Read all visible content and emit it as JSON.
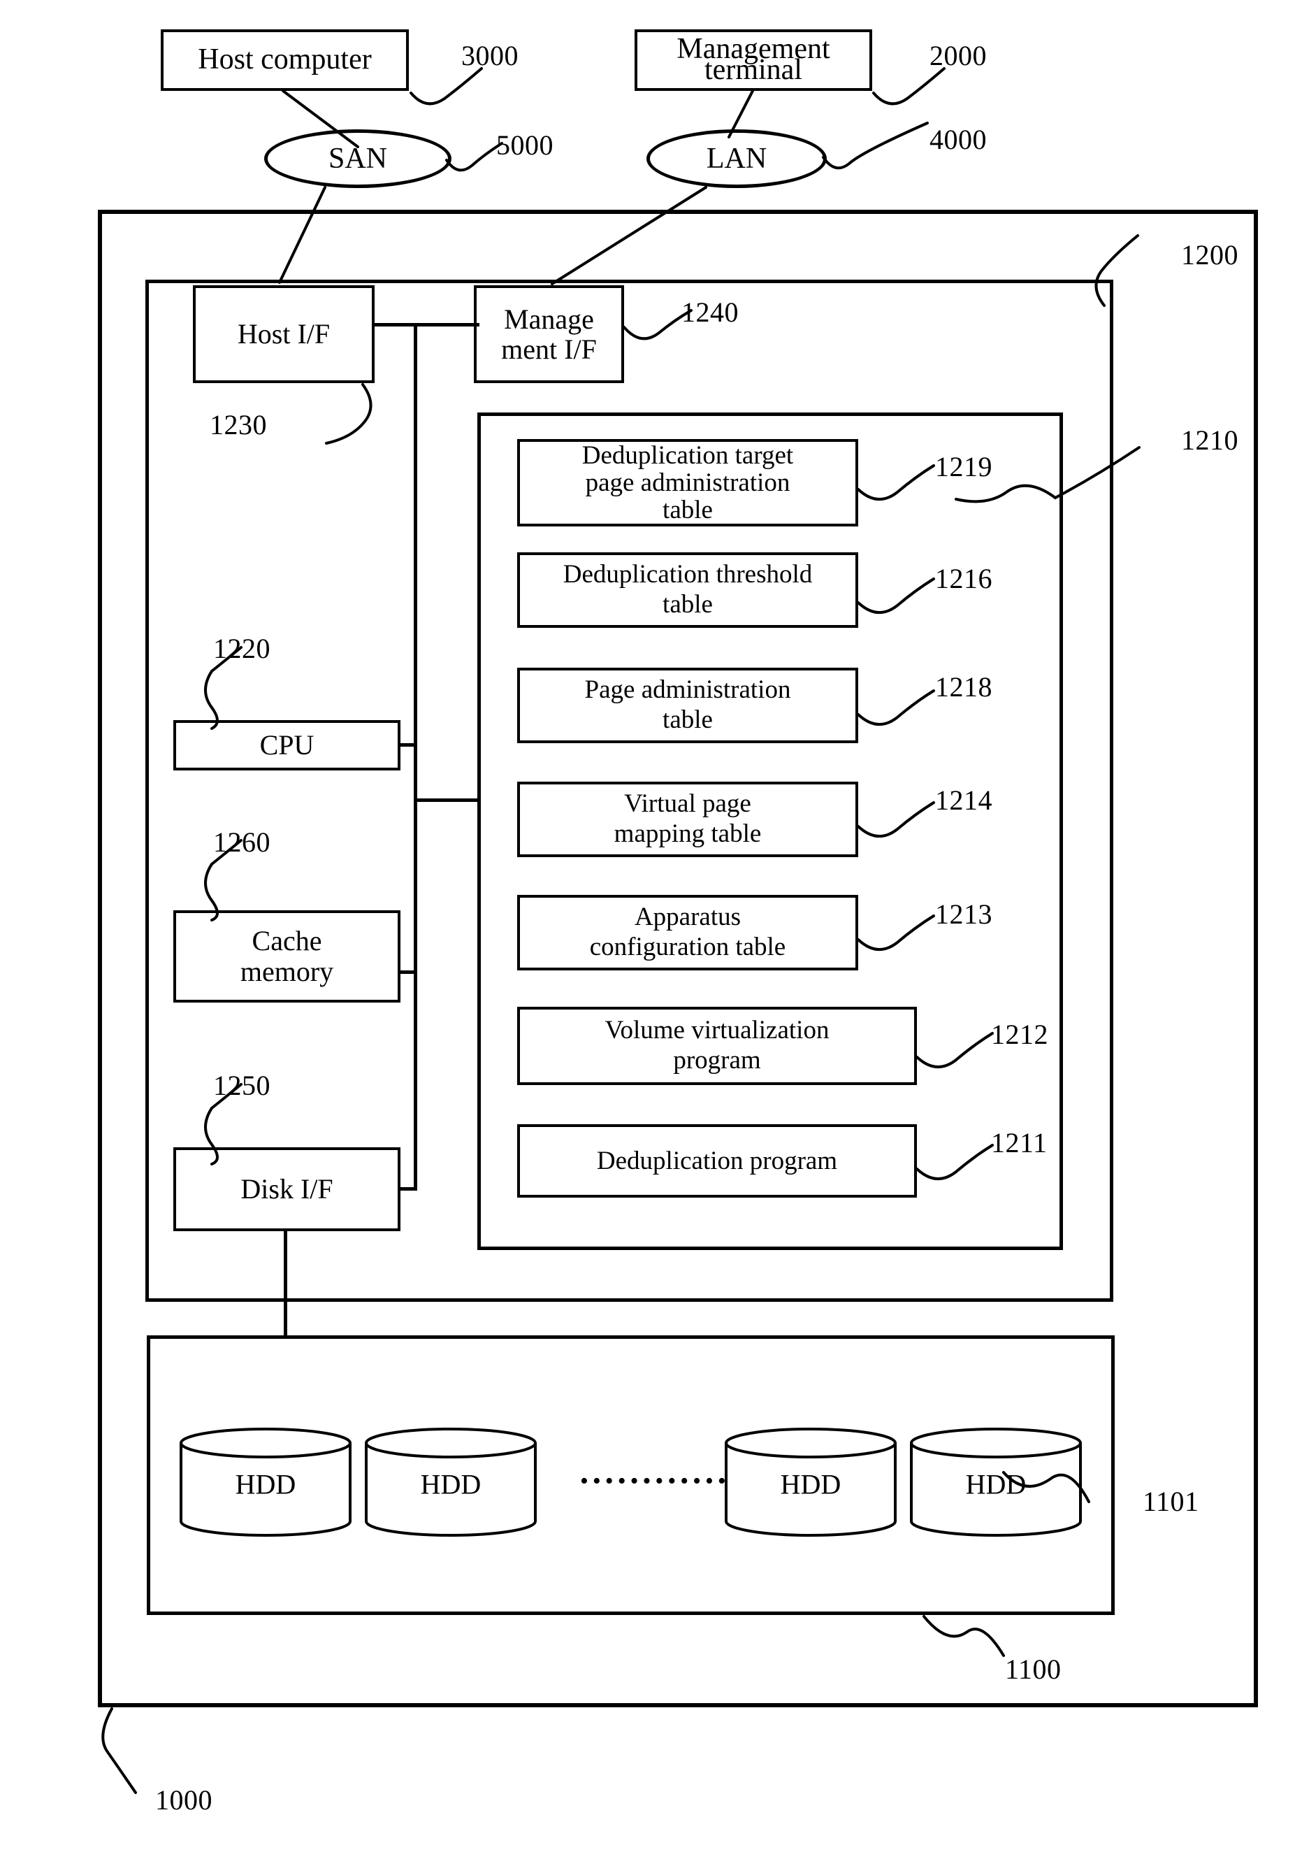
{
  "figure": {
    "type": "patent-block-diagram",
    "title": "Storage apparatus block diagram"
  },
  "external": {
    "host_computer": {
      "label": "Host computer",
      "ref": "3000"
    },
    "management_terminal": {
      "label": "Management\nterminal",
      "label_line1": "Management",
      "label_line2": "terminal",
      "ref": "2000"
    },
    "san": {
      "label": "SAN",
      "ref": "5000"
    },
    "lan": {
      "label": "LAN",
      "ref": "4000"
    }
  },
  "system": {
    "ref": "1000",
    "storage_apparatus_ref": "1000"
  },
  "controller": {
    "ref": "1200",
    "interfaces": [
      {
        "label": "Host I/F",
        "ref": "1230",
        "name": "host-if"
      },
      {
        "label_line1": "Manage",
        "label_line2": "ment I/F",
        "ref": "1240",
        "name": "management-if"
      }
    ],
    "components": [
      {
        "label": "CPU",
        "ref": "1220",
        "name": "cpu"
      },
      {
        "label_line1": "Cache",
        "label_line2": "memory",
        "ref": "1260",
        "name": "cache-memory"
      },
      {
        "label": "Disk I/F",
        "ref": "1250",
        "name": "disk-if"
      }
    ]
  },
  "memory": {
    "ref": "1210",
    "items": [
      {
        "lines": [
          "Deduplication target",
          "page administration",
          "table"
        ],
        "ref": "1219",
        "name": "deduplication-target-page-administration-table"
      },
      {
        "lines": [
          "Deduplication threshold",
          "table"
        ],
        "ref": "1216",
        "name": "deduplication-threshold-table"
      },
      {
        "lines": [
          "Page administration",
          "table"
        ],
        "ref": "1218",
        "name": "page-administration-table"
      },
      {
        "lines": [
          "Virtual page",
          "mapping table"
        ],
        "ref": "1214",
        "name": "virtual-page-mapping-table"
      },
      {
        "lines": [
          "Apparatus",
          "configuration table"
        ],
        "ref": "1213",
        "name": "apparatus-configuration-table"
      },
      {
        "lines": [
          "Volume virtualization",
          "program"
        ],
        "ref": "1212",
        "name": "volume-virtualization-program"
      },
      {
        "lines": [
          "Deduplication program"
        ],
        "ref": "1211",
        "name": "deduplication-program"
      }
    ]
  },
  "disk_unit": {
    "ref": "1100",
    "hdd_ref": "1101",
    "hdds": [
      {
        "label": "HDD"
      },
      {
        "label": "HDD"
      },
      {
        "label": "HDD"
      },
      {
        "label": "HDD"
      }
    ],
    "ellipsis": "••••••••••••"
  },
  "colors": {
    "line": "#000000",
    "background": "#ffffff"
  }
}
